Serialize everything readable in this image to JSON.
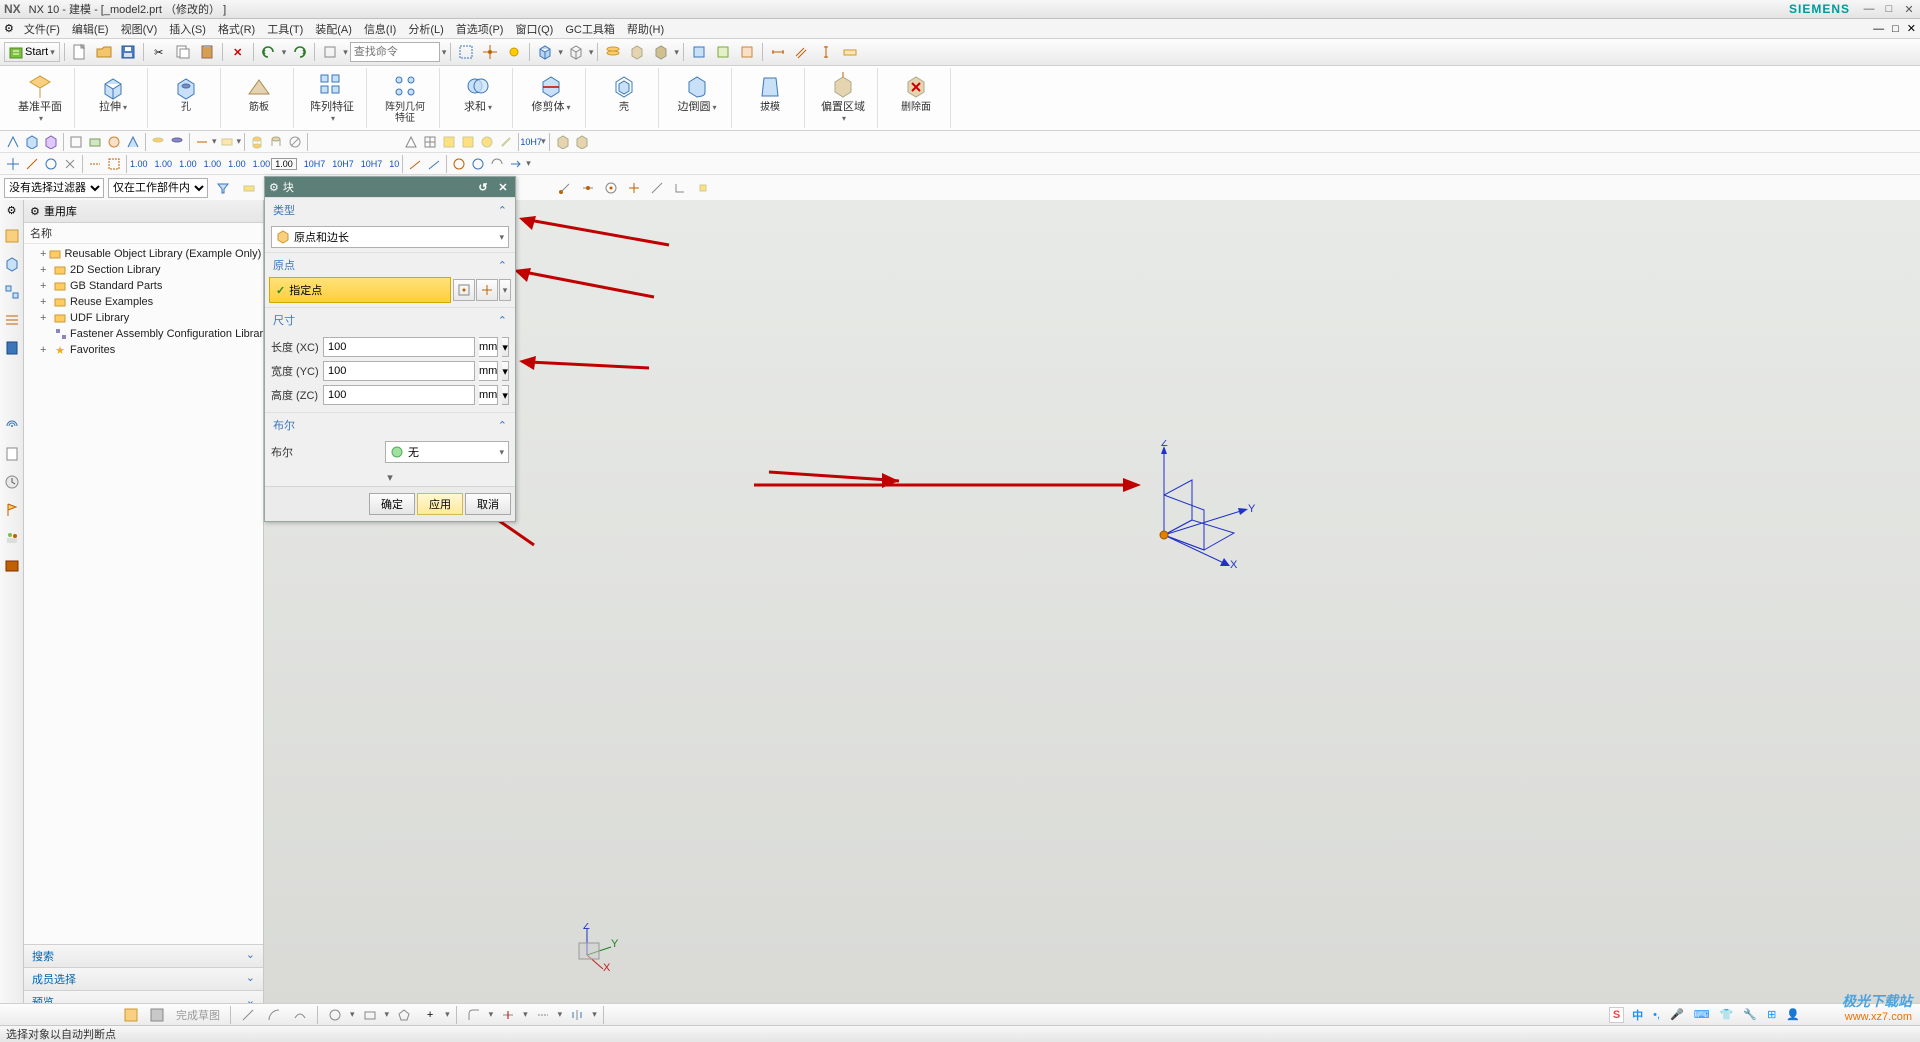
{
  "title": {
    "app": "NX 10",
    "doc": "建模 - [_model2.prt （修改的）  ]",
    "brand": "SIEMENS"
  },
  "menu": {
    "file": "文件(F)",
    "edit": "编辑(E)",
    "view": "视图(V)",
    "insert": "插入(S)",
    "format": "格式(R)",
    "tools": "工具(T)",
    "assembly": "装配(A)",
    "info": "信息(I)",
    "analysis": "分析(L)",
    "preferences": "首选项(P)",
    "window": "窗口(Q)",
    "gc": "GC工具箱",
    "help": "帮助(H)"
  },
  "toolbar": {
    "start": "Start",
    "search_placeholder": "查找命令"
  },
  "ribbon": {
    "datum": "基准平面",
    "extrude": "拉伸",
    "hole": "孔",
    "rib": "筋板",
    "pattern_feat": "阵列特征",
    "pattern_geom": "阵列几何特征",
    "sum": "求和",
    "trim": "修剪体",
    "shell": "壳",
    "chamfer": "边倒圆",
    "draft": "拔模",
    "offset_region": "偏置区域",
    "delete_face": "删除面"
  },
  "dims": {
    "v1": "1.00",
    "v2": "1.00",
    "v3": "1.00",
    "v4": "1.00",
    "v5": "1.00",
    "v6": "1.00",
    "v7": "1.00",
    "h1": "10H7",
    "h2": "10H7",
    "h3": "10H7",
    "h4": "10"
  },
  "filters": {
    "none": "没有选择过滤器",
    "work": "仅在工作部件内"
  },
  "sidepanel": {
    "title": "重用库",
    "subtitle": "名称",
    "items": [
      {
        "exp": "+",
        "label": "Reusable Object Library (Example Only)",
        "icon": "library"
      },
      {
        "exp": "+",
        "label": "2D Section Library",
        "icon": "library"
      },
      {
        "exp": "+",
        "label": "GB Standard Parts",
        "icon": "library"
      },
      {
        "exp": "+",
        "label": "Reuse Examples",
        "icon": "library"
      },
      {
        "exp": "+",
        "label": "UDF Library",
        "icon": "library"
      },
      {
        "exp": "",
        "label": "Fastener Assembly Configuration Library",
        "icon": "fastener"
      },
      {
        "exp": "+",
        "label": "Favorites",
        "icon": "star"
      }
    ],
    "search": "搜索",
    "member": "成员选择",
    "preview": "预览"
  },
  "dialog": {
    "title": "块",
    "sections": {
      "type": "类型",
      "origin": "原点",
      "size": "尺寸",
      "boolean": "布尔"
    },
    "type_value": "原点和边长",
    "specify": "指定点",
    "length_lbl": "长度 (XC)",
    "length_val": "100",
    "width_lbl": "宽度 (YC)",
    "width_val": "100",
    "height_lbl": "高度 (ZC)",
    "height_val": "100",
    "unit": "mm",
    "boolean_val": "无",
    "ok": "确定",
    "apply": "应用",
    "cancel": "取消"
  },
  "axes": {
    "x": "X",
    "y": "Y",
    "z": "Z"
  },
  "status": "选择对象以自动判断点",
  "bottomtxt": "完成草图",
  "watermark": {
    "l1": "极光下载站",
    "l2": "www.xz7.com"
  }
}
